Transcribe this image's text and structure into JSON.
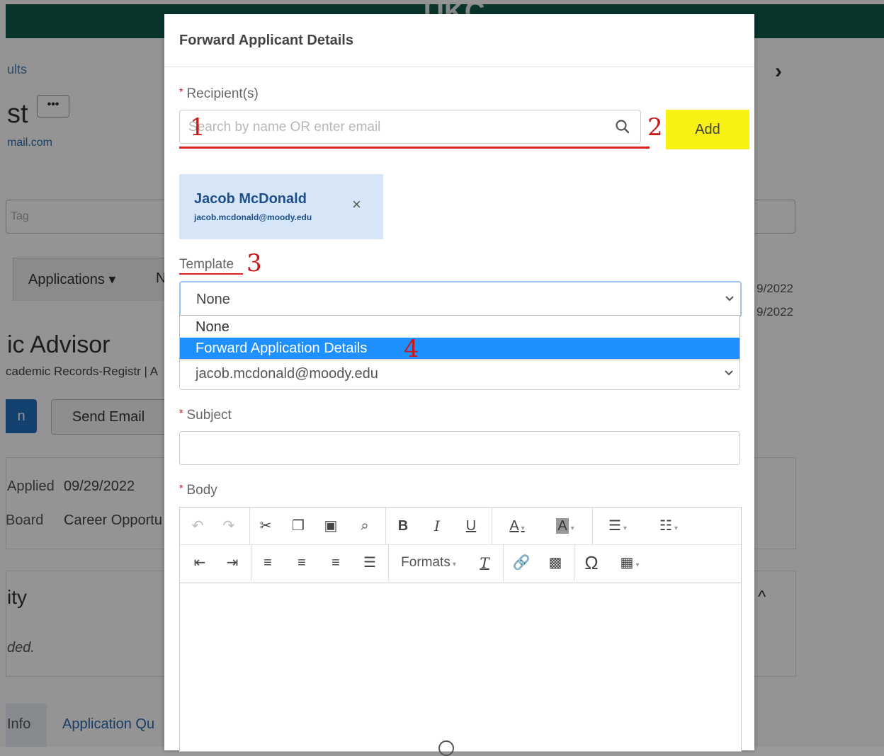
{
  "background": {
    "logo_text": "UKC",
    "results_link": "ults",
    "candidate_name": "st",
    "more_button": "•••",
    "candidate_email": "mail.com",
    "tag_placeholder": "Tag",
    "tab_applications": "Applications",
    "tab_next": "N",
    "date_1": "9/2022",
    "date_2": "9/2022",
    "job_title": "ic Advisor",
    "department": "cademic Records-Registr | A",
    "primary_button": "n",
    "send_email_button": "Send Email",
    "applied_label": "Applied",
    "applied_value": "09/29/2022",
    "board_label": "Board",
    "board_value": "Career Opportu",
    "activity_heading": "ity",
    "activity_note": "ded.",
    "info_tab": "Info",
    "application_questions_tab": "Application Qu",
    "next_arrow": "›",
    "chevron_up": "^"
  },
  "modal": {
    "title": "Forward Applicant Details",
    "recipients_label": "Recipient(s)",
    "search_placeholder": "Search by name OR enter email",
    "add_button": "Add",
    "selected_recipient": {
      "name": "Jacob McDonald",
      "email": "jacob.mcdonald@moody.edu"
    },
    "remove_icon": "×",
    "template_label": "Template",
    "template_selected": "None",
    "template_options": [
      "None",
      "Forward Application Details"
    ],
    "from_value": "jacob.mcdonald@moody.edu",
    "subject_label": "Subject",
    "subject_value": "",
    "body_label": "Body",
    "toolbar": {
      "formats_label": "Formats"
    }
  },
  "annotations": {
    "step_1": "1",
    "step_2": "2",
    "step_3": "3",
    "step_4": "4",
    "underline_color": "#dd2222",
    "highlight_color": "#f8f214"
  },
  "colors": {
    "topbar": "#0e5a4a",
    "selected_option": "#1e90ff",
    "chip_bg": "#d6e6f7",
    "chip_text": "#1f4f8a"
  }
}
